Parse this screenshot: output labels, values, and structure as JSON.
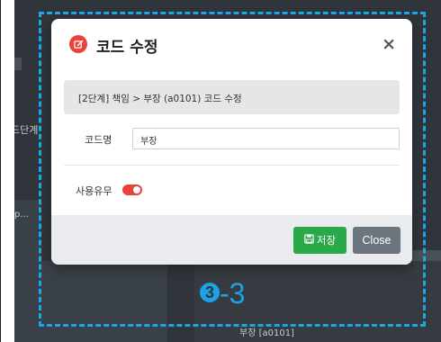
{
  "background": {
    "left_text": "드단계",
    "left_truncated": "p...",
    "bottom_text": "부장 [a0101]"
  },
  "modal": {
    "title": "코드 수정",
    "close_glyph": "×",
    "info_text": "[2단계] 책임 > 부장 (a0101) 코드 수정",
    "code_name_label": "코드명",
    "code_name_value": "부장",
    "use_label": "사용유무",
    "use_enabled": true,
    "save_label": "저장",
    "close_label": "Close"
  },
  "annotation": {
    "circled_number": "3",
    "separator": "-",
    "trailing_number": "3"
  },
  "colors": {
    "accent_red": "#e8423a",
    "save_green": "#2aa84a",
    "close_gray": "#6c757d",
    "annotation_blue": "#1aa3e6"
  },
  "icons": [
    "edit-icon",
    "close-icon",
    "save-icon",
    "toggle-switch"
  ]
}
